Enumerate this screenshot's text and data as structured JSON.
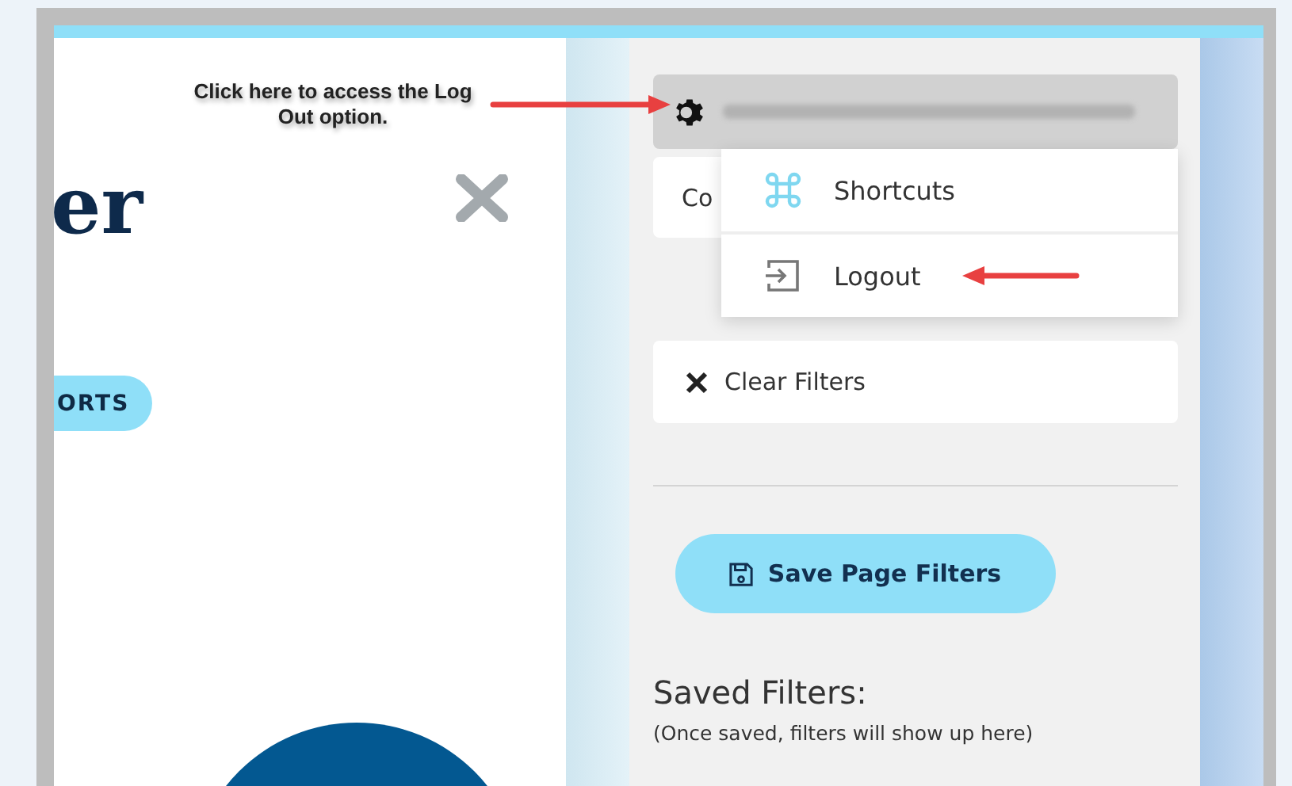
{
  "callout": {
    "text": "Click here to access the Log Out option."
  },
  "left_panel": {
    "title_fragment": "er",
    "button_fragment": "ORTS"
  },
  "side_panel": {
    "account_menu": {
      "expanded": true,
      "items": [
        {
          "kind": "shortcuts",
          "label": "Shortcuts"
        },
        {
          "kind": "logout",
          "label": "Logout"
        }
      ]
    },
    "covered_card": {
      "label": "Co"
    },
    "clear_filters": {
      "label": "Clear Filters"
    },
    "save_button": {
      "label": "Save Page Filters"
    },
    "saved_filters": {
      "heading": "Saved Filters:",
      "hint": "(Once saved, filters will show up here)"
    }
  }
}
